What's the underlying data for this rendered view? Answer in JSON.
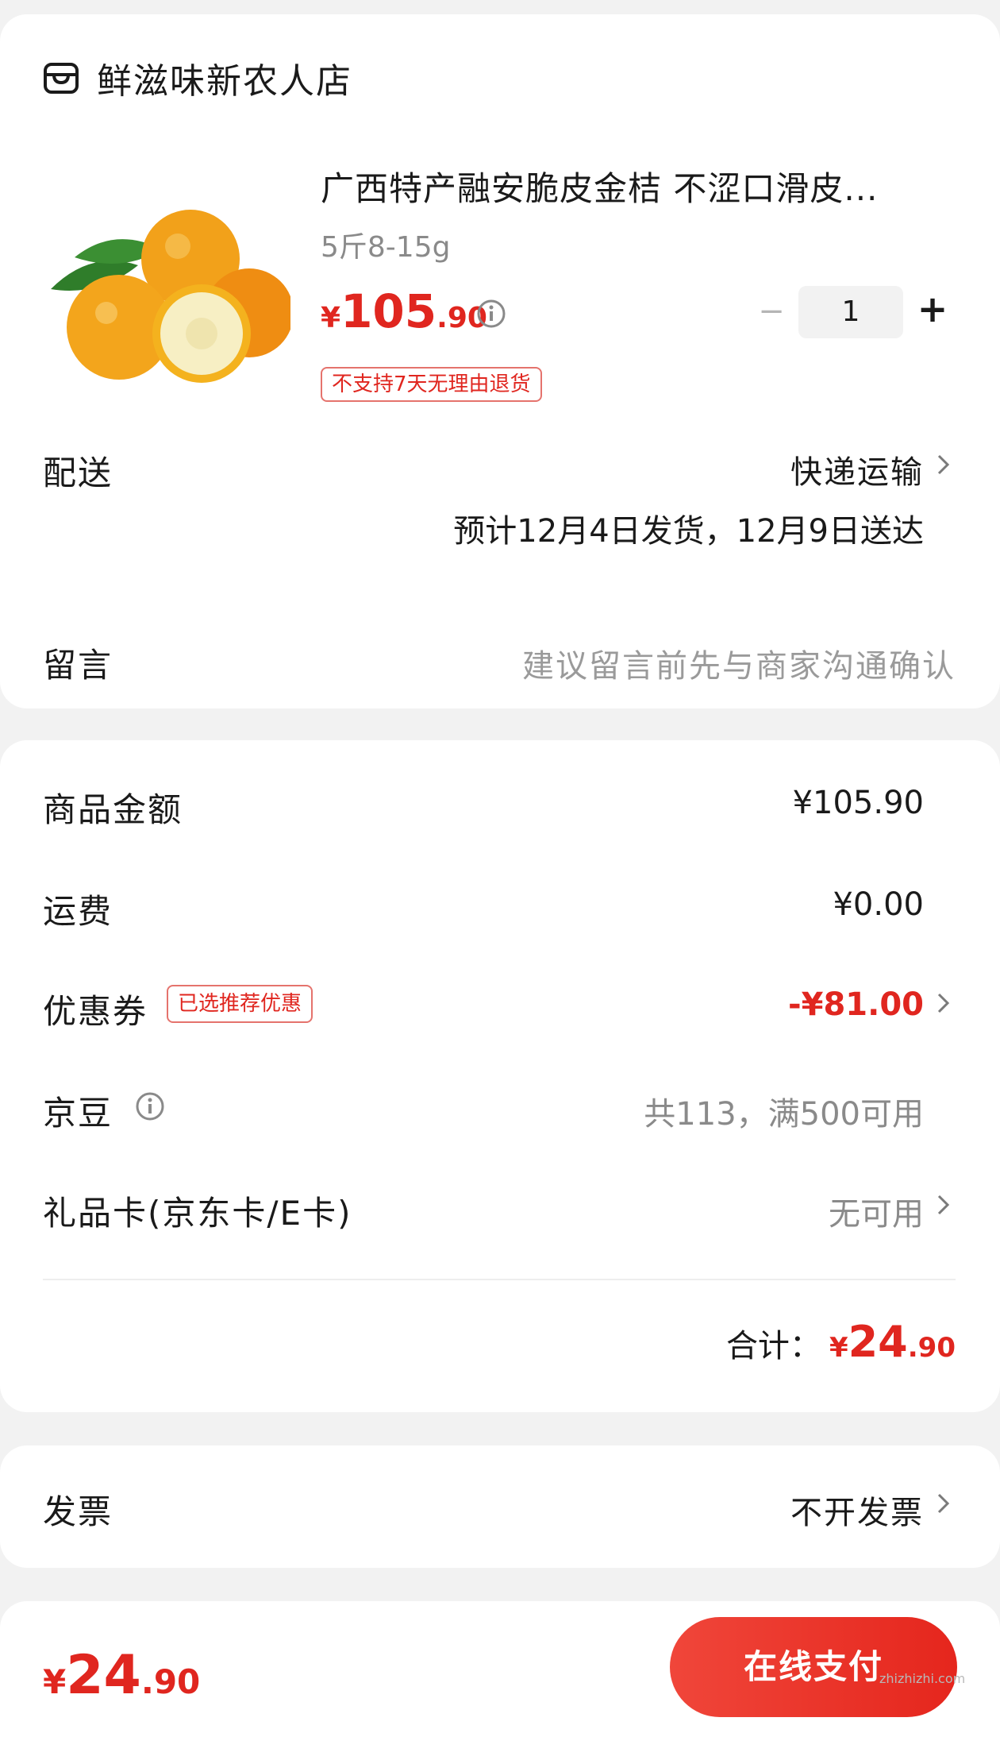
{
  "shop": {
    "icon": "store-icon",
    "name": "鲜滋味新农人店"
  },
  "product": {
    "image": "kumquat-product-image",
    "title": "广西特产融安脆皮金桔 不涩口滑皮...",
    "spec": "5斤8-15g",
    "price": {
      "currency": "¥",
      "integer": "105",
      "decimal": ".90"
    },
    "quantity": "1",
    "minus_symbol": "−",
    "plus_symbol": "+",
    "return_badge": "不支持7天无理由退货"
  },
  "delivery": {
    "label": "配送",
    "method": "快递运输",
    "estimate": "预计12月4日发货，12月9日送达"
  },
  "message": {
    "label": "留言",
    "placeholder": "建议留言前先与商家沟通确认"
  },
  "summary": {
    "goods_label": "商品金额",
    "goods_value": "¥105.90",
    "freight_label": "运费",
    "freight_value": "¥0.00",
    "coupon_label": "优惠券",
    "coupon_badge": "已选推荐优惠",
    "coupon_value": "-¥81.00",
    "jingdou_label": "京豆",
    "jingdou_value": "共113，满500可用",
    "giftcard_label": "礼品卡(京东卡/E卡)",
    "giftcard_value": "无可用",
    "total_label": "合计：",
    "total": {
      "currency": "¥",
      "integer": "24",
      "decimal": ".90"
    }
  },
  "invoice": {
    "label": "发票",
    "value": "不开发票"
  },
  "bottom_bar": {
    "price": {
      "currency": "¥",
      "integer": "24",
      "decimal": ".90"
    },
    "pay_button": "在线支付"
  },
  "watermark": "zhizhizhi.com",
  "colors": {
    "accent_red": "#e0261f",
    "muted_text": "#8a8a8a",
    "page_bg": "#f2f2f2"
  }
}
